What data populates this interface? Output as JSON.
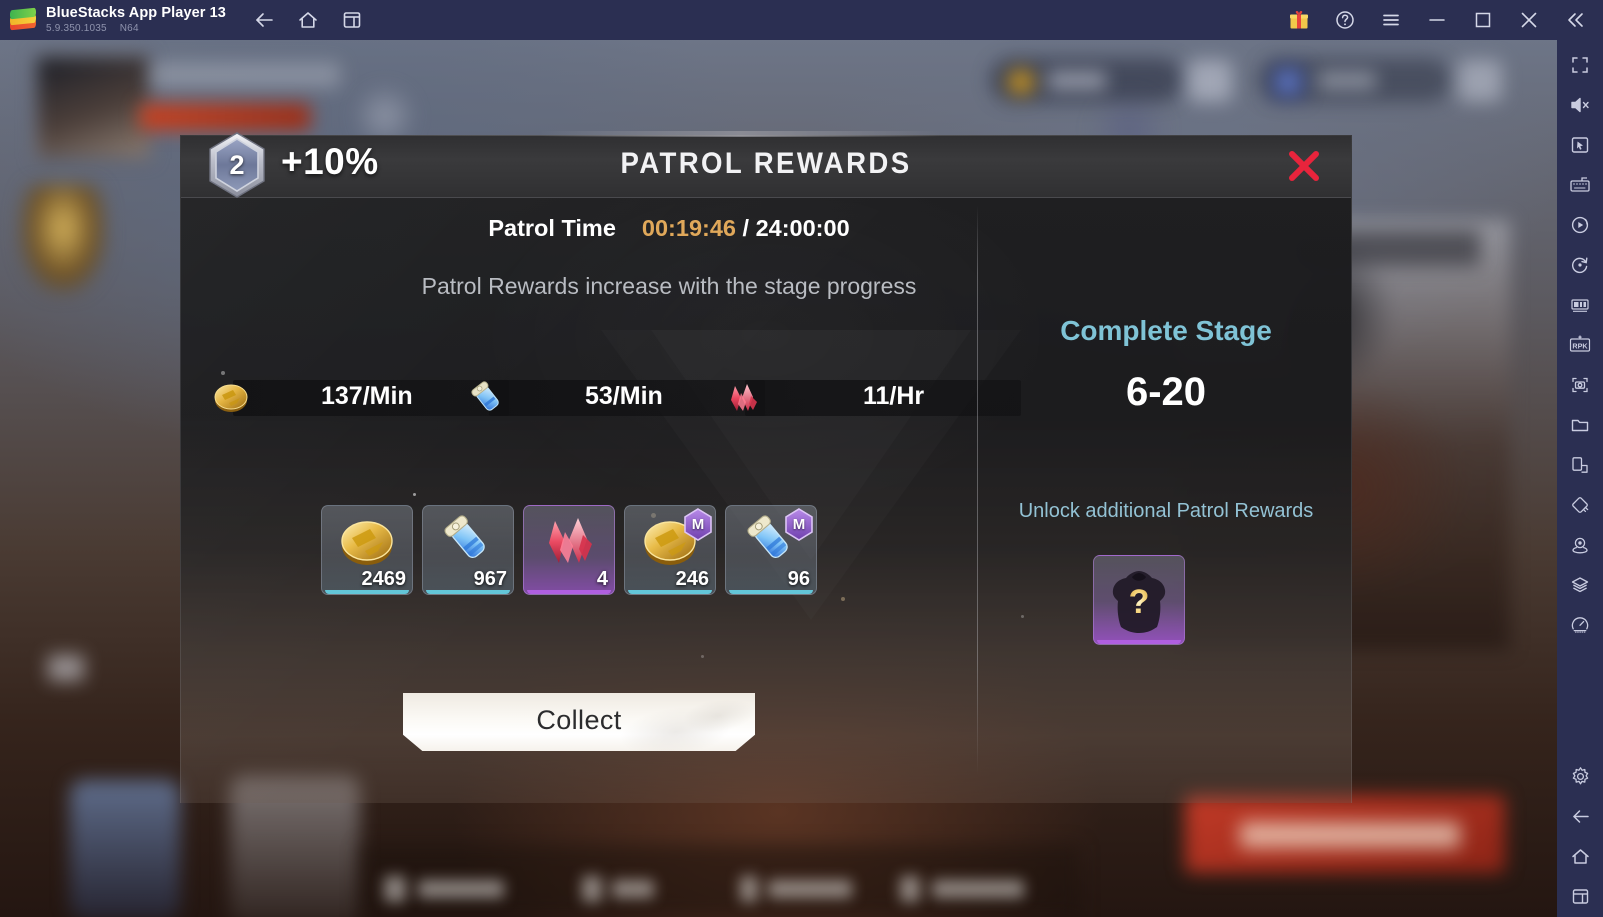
{
  "titlebar": {
    "app_title": "BlueStacks App Player 13",
    "version": "5.9.350.1035",
    "build": "N64",
    "nav": [
      {
        "name": "back-icon",
        "label": "Back"
      },
      {
        "name": "home-icon",
        "label": "Home"
      },
      {
        "name": "multi-instance-icon",
        "label": "Multi-instance"
      }
    ],
    "right": [
      {
        "name": "gift-icon",
        "label": "Rewards"
      },
      {
        "name": "help-icon",
        "label": "Help"
      },
      {
        "name": "menu-icon",
        "label": "Menu"
      },
      {
        "name": "minimize-icon",
        "label": "Minimize"
      },
      {
        "name": "maximize-icon",
        "label": "Maximize"
      },
      {
        "name": "close-icon",
        "label": "Close"
      },
      {
        "name": "collapse-icon",
        "label": "Collapse sidebar"
      }
    ]
  },
  "sidebar": {
    "items": [
      {
        "name": "fullscreen-icon",
        "label": "Full screen"
      },
      {
        "name": "volume-mute-icon",
        "label": "Volume"
      },
      {
        "name": "cursor-box-icon",
        "label": "Game controls"
      },
      {
        "name": "keyboard-icon",
        "label": "Keymapping"
      },
      {
        "name": "macro-play-icon",
        "label": "Macro recorder"
      },
      {
        "name": "rotate-icon",
        "label": "Rotate"
      },
      {
        "name": "multi-instance-manager-icon",
        "label": "Multi-instance manager"
      },
      {
        "name": "rpk-icon",
        "label": "RPK"
      },
      {
        "name": "screenshot-icon",
        "label": "Screenshot"
      },
      {
        "name": "folder-icon",
        "label": "Media manager"
      },
      {
        "name": "install-apk-icon",
        "label": "Install APK"
      },
      {
        "name": "shake-icon",
        "label": "Shake"
      },
      {
        "name": "location-icon",
        "label": "Location"
      },
      {
        "name": "layers-icon",
        "label": "Layers"
      },
      {
        "name": "performance-icon",
        "label": "Performance"
      }
    ],
    "bottom": [
      {
        "name": "settings-gear-icon",
        "label": "Settings"
      },
      {
        "name": "back-icon",
        "label": "Back"
      },
      {
        "name": "home-icon",
        "label": "Home"
      },
      {
        "name": "recents-icon",
        "label": "Recents"
      }
    ]
  },
  "modal": {
    "title": "PATROL REWARDS",
    "boost_level": "2",
    "boost_percent": "+10%",
    "close_label": "Close",
    "patrol_time": {
      "label": "Patrol Time",
      "current": "00:19:46",
      "separator": "/",
      "total": "24:00:00",
      "current_color": "#e0a85a"
    },
    "subtitle": "Patrol Rewards increase with the stage progress",
    "rates": [
      {
        "icon": "gold-coin-icon",
        "value": "137/Min"
      },
      {
        "icon": "blue-potion-icon",
        "value": "53/Min"
      },
      {
        "icon": "red-crystal-icon",
        "value": "11/Hr"
      }
    ],
    "rewards": [
      {
        "icon": "gold-coin-icon",
        "qty": "2469",
        "rarity": "blue",
        "badge": ""
      },
      {
        "icon": "blue-potion-icon",
        "qty": "967",
        "rarity": "blue",
        "badge": ""
      },
      {
        "icon": "red-crystal-icon",
        "qty": "4",
        "rarity": "purple",
        "badge": ""
      },
      {
        "icon": "gold-coin-icon",
        "qty": "246",
        "rarity": "blue",
        "badge": "M"
      },
      {
        "icon": "blue-potion-icon",
        "qty": "96",
        "rarity": "blue",
        "badge": "M"
      }
    ],
    "collect_label": "Collect",
    "right_panel": {
      "complete_stage_label": "Complete Stage",
      "complete_stage_value": "6-20",
      "complete_stage_color": "#7fc3d6",
      "unlock_label": "Unlock additional Patrol Rewards",
      "unlock_icon": "locked-armor-question-icon"
    }
  }
}
